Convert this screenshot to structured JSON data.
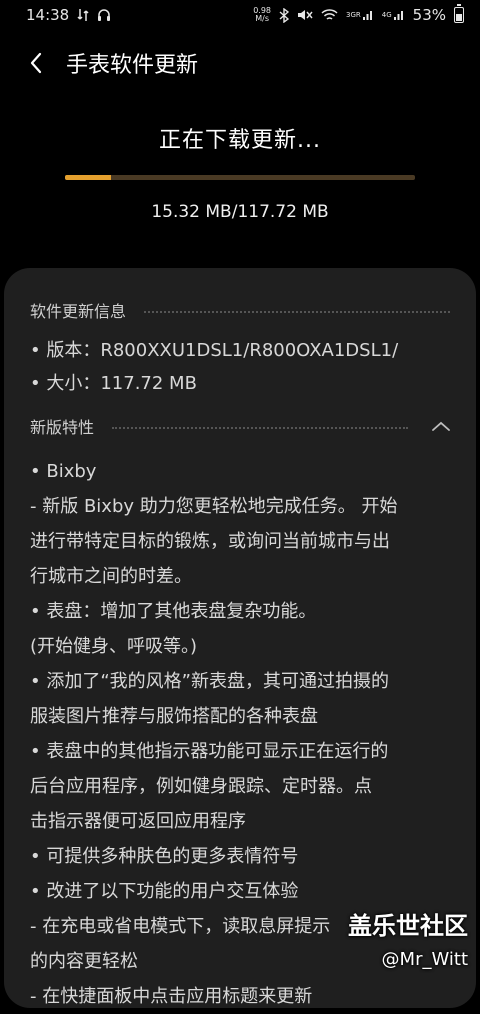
{
  "status_bar": {
    "time": "14:38",
    "net_speed_value": "0.98",
    "net_speed_unit": "M/s",
    "network_labels": [
      "3GR",
      "4G"
    ],
    "battery_percent": "53%",
    "battery_level": 0.53
  },
  "header": {
    "title": "手表软件更新"
  },
  "download": {
    "title": "正在下载更新...",
    "size_text": "15.32 MB/117.72 MB",
    "progress": 0.13,
    "accent_color": "#e4a02e"
  },
  "info": {
    "title": "软件更新信息",
    "version_line": "• 版本：R800XXU1DSL1/R800OXA1DSL1/",
    "size_line": "• 大小：117.72 MB"
  },
  "features": {
    "title": "新版特性",
    "lines": [
      "• Bixby",
      " - 新版 Bixby 助力您更轻松地完成任务。 开始",
      "进行带特定目标的锻炼，或询问当前城市与出",
      "行城市之间的时差。",
      "• 表盘：增加了其他表盘复杂功能。",
      " (开始健身、呼吸等。)",
      "• 添加了“我的风格”新表盘，其可通过拍摄的",
      "服装图片推荐与服饰搭配的各种表盘",
      "• 表盘中的其他指示器功能可显示正在运行的",
      "后台应用程序，例如健身跟踪、定时器。点",
      "击指示器便可返回应用程序",
      "• 可提供多种肤色的更多表情符号",
      "• 改进了以下功能的用户交互体验",
      " - 在充电或省电模式下，读取息屏提示",
      "的内容更轻松",
      " - 在快捷面板中点击应用标题来更新"
    ]
  },
  "watermark": {
    "logo": "盖乐世社区",
    "user": "@Mr_Witt"
  }
}
